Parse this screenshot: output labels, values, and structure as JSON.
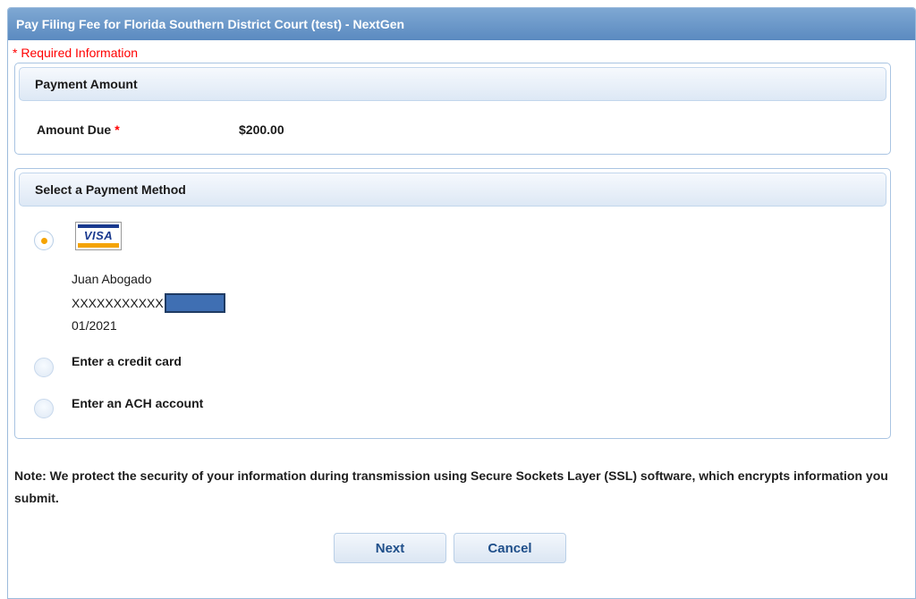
{
  "window": {
    "title": "Pay Filing Fee for Florida Southern District Court (test) - NextGen"
  },
  "required_note": "* Required Information",
  "payment_amount": {
    "header": "Payment Amount",
    "amount_due_label": "Amount Due",
    "required_marker": "*",
    "amount_due_value": "$200.00"
  },
  "payment_method": {
    "header": "Select a Payment Method",
    "saved_card": {
      "brand": "VISA",
      "name": "Juan Abogado",
      "number_masked": "XXXXXXXXXXX",
      "expiry": "01/2021",
      "selected": true
    },
    "options": [
      {
        "label": "Enter a credit card",
        "selected": false
      },
      {
        "label": "Enter an ACH account",
        "selected": false
      }
    ]
  },
  "security_note": "Note: We protect the security of your information during transmission using Secure Sockets Layer (SSL) software, which encrypts information you submit.",
  "buttons": {
    "next_label": "Next",
    "cancel_label": "Cancel"
  },
  "colors": {
    "title_bar": "#6b96c8",
    "required": "#ff0000",
    "radio_selected_dot": "#f5a300",
    "button_text": "#1f4f8a"
  }
}
